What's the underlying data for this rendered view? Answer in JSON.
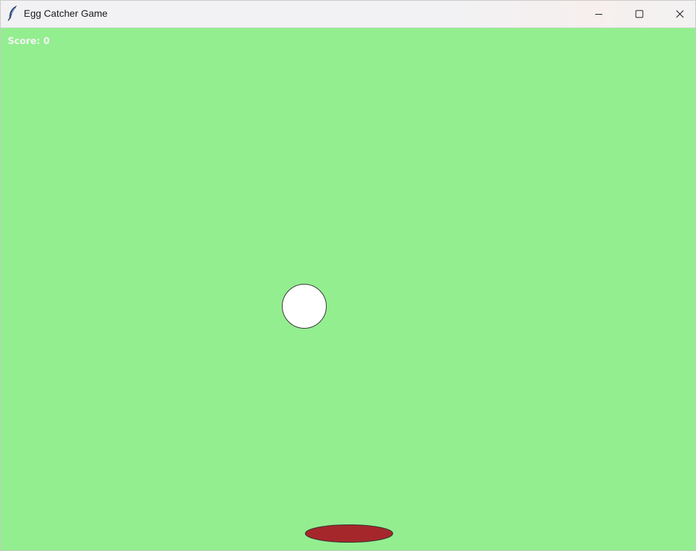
{
  "window": {
    "title": "Egg Catcher Game",
    "icon": "feather-icon",
    "controls": [
      "minimize-icon",
      "maximize-icon",
      "close-icon"
    ]
  },
  "game": {
    "background_color": "#93ee90",
    "score_label": "Score: 0",
    "score_color": "#f4f4f4",
    "egg": {
      "fill": "#ffffff",
      "outline": "#333333"
    },
    "catcher": {
      "fill": "#a5272b",
      "outline": "#333333"
    }
  }
}
